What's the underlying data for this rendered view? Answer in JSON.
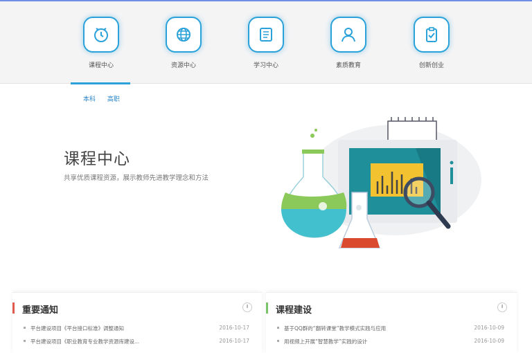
{
  "nav": {
    "items": [
      {
        "label": "课程中心",
        "icon": "clock-icon"
      },
      {
        "label": "资源中心",
        "icon": "globe-icon"
      },
      {
        "label": "学习中心",
        "icon": "document-icon"
      },
      {
        "label": "素质教育",
        "icon": "person-icon"
      },
      {
        "label": "创新创业",
        "icon": "clipboard-icon"
      }
    ],
    "active_index": 0
  },
  "subtabs": [
    "本科",
    "高职"
  ],
  "hero": {
    "title": "课程中心",
    "subtitle": "共享优质课程资源，展示教师先进教学理念和方法"
  },
  "panels": {
    "notices": {
      "title": "重要通知",
      "accent": "#e05a4f",
      "items": [
        {
          "text": "平台建设项目《平台接口标准》调整通知",
          "date": "2016-10-17"
        },
        {
          "text": "平台建设项目《职业教育专业教学资源库建设...",
          "date": "2016-10-17"
        }
      ]
    },
    "course": {
      "title": "课程建设",
      "accent": "#7cc46b",
      "items": [
        {
          "text": "基于QQ群的“翻转课堂”教学模式实践与应用",
          "date": "2016-10-09"
        },
        {
          "text": "用视频上开展“智慧教学”实践的设计",
          "date": "2016-10-09"
        }
      ]
    }
  },
  "colors": {
    "primary": "#2aa2d9",
    "topline": "#6f8fe6"
  }
}
